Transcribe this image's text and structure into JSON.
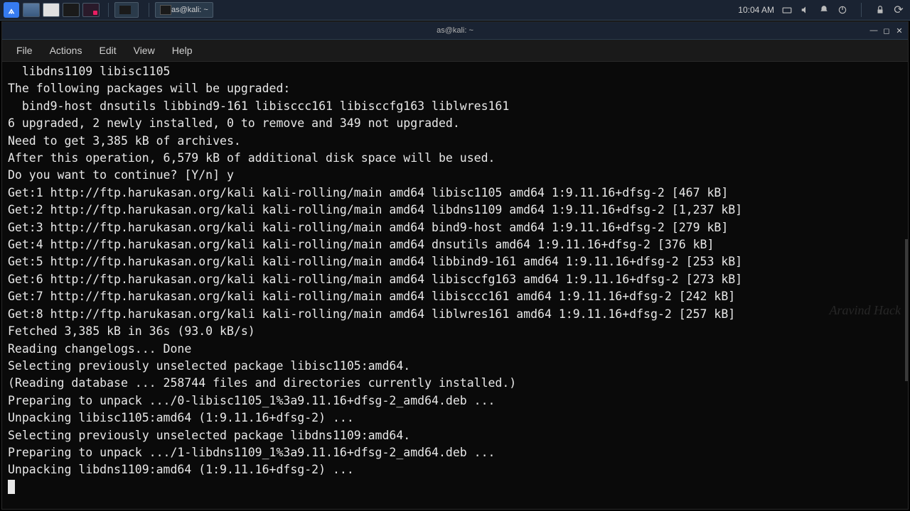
{
  "panel": {
    "taskbar_title": "as@kali: ~",
    "clock": "10:04 AM"
  },
  "window": {
    "title": "as@kali: ~"
  },
  "menu": {
    "file": "File",
    "actions": "Actions",
    "edit": "Edit",
    "view": "View",
    "help": "Help"
  },
  "terminal": {
    "lines": [
      "  libdns1109 libisc1105",
      "The following packages will be upgraded:",
      "  bind9-host dnsutils libbind9-161 libisccc161 libisccfg163 liblwres161",
      "6 upgraded, 2 newly installed, 0 to remove and 349 not upgraded.",
      "Need to get 3,385 kB of archives.",
      "After this operation, 6,579 kB of additional disk space will be used.",
      "Do you want to continue? [Y/n] y",
      "Get:1 http://ftp.harukasan.org/kali kali-rolling/main amd64 libisc1105 amd64 1:9.11.16+dfsg-2 [467 kB]",
      "Get:2 http://ftp.harukasan.org/kali kali-rolling/main amd64 libdns1109 amd64 1:9.11.16+dfsg-2 [1,237 kB]",
      "Get:3 http://ftp.harukasan.org/kali kali-rolling/main amd64 bind9-host amd64 1:9.11.16+dfsg-2 [279 kB]",
      "Get:4 http://ftp.harukasan.org/kali kali-rolling/main amd64 dnsutils amd64 1:9.11.16+dfsg-2 [376 kB]",
      "Get:5 http://ftp.harukasan.org/kali kali-rolling/main amd64 libbind9-161 amd64 1:9.11.16+dfsg-2 [253 kB]",
      "Get:6 http://ftp.harukasan.org/kali kali-rolling/main amd64 libisccfg163 amd64 1:9.11.16+dfsg-2 [273 kB]",
      "Get:7 http://ftp.harukasan.org/kali kali-rolling/main amd64 libisccc161 amd64 1:9.11.16+dfsg-2 [242 kB]",
      "Get:8 http://ftp.harukasan.org/kali kali-rolling/main amd64 liblwres161 amd64 1:9.11.16+dfsg-2 [257 kB]",
      "Fetched 3,385 kB in 36s (93.0 kB/s)",
      "Reading changelogs... Done",
      "Selecting previously unselected package libisc1105:amd64.",
      "(Reading database ... 258744 files and directories currently installed.)",
      "Preparing to unpack .../0-libisc1105_1%3a9.11.16+dfsg-2_amd64.deb ...",
      "Unpacking libisc1105:amd64 (1:9.11.16+dfsg-2) ...",
      "Selecting previously unselected package libdns1109:amd64.",
      "Preparing to unpack .../1-libdns1109_1%3a9.11.16+dfsg-2_amd64.deb ...",
      "Unpacking libdns1109:amd64 (1:9.11.16+dfsg-2) ..."
    ]
  },
  "watermark": "Aravind Hack"
}
